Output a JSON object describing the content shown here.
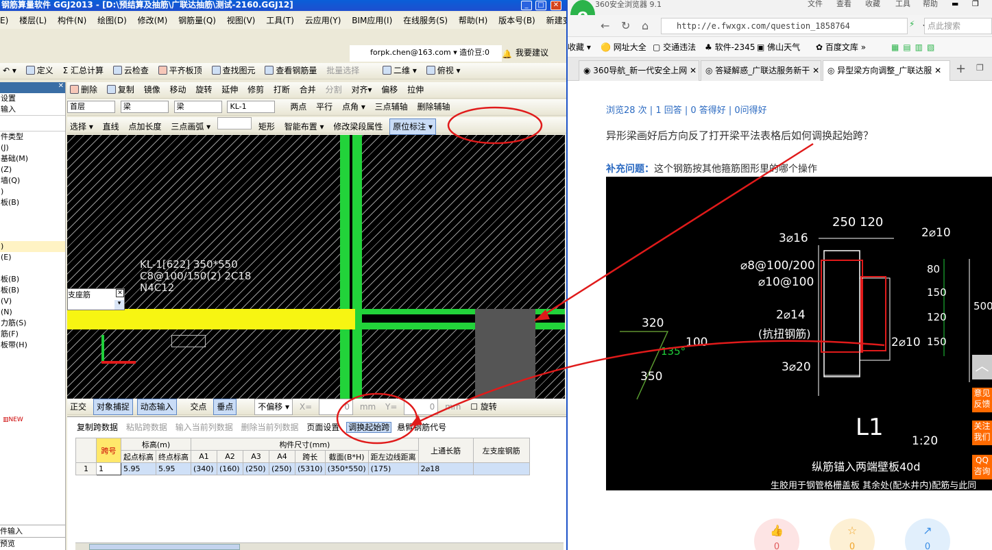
{
  "left": {
    "title": "钢筋算量软件 GGJ2013 - [D:\\预结算及抽筋\\广联达抽筋\\测试-2160.GGJ12]",
    "menu": [
      "E)",
      "楼层(L)",
      "构件(N)",
      "绘图(D)",
      "修改(M)",
      "钢筋量(Q)",
      "视图(V)",
      "工具(T)",
      "云应用(Y)",
      "BIM应用(I)",
      "在线服务(S)",
      "帮助(H)",
      "版本号(B)",
      "新建变更 ▾"
    ],
    "account": "forpk.chen@163.com ▾  造价豆:0",
    "suggest": "我要建议",
    "tb1": [
      "定义",
      "Σ 汇总计算",
      "云检查",
      "平齐板顶",
      "查找图元",
      "查看钢筋量",
      "批量选择",
      "二维 ▾",
      "俯视 ▾"
    ],
    "tb2": [
      "删除",
      "复制",
      "镜像",
      "移动",
      "旋转",
      "延伸",
      "修剪",
      "打断",
      "合并",
      "分割",
      "对齐▾",
      "偏移",
      "拉伸"
    ],
    "tb3_sel": [
      "首层",
      "梁",
      "梁",
      "KL-1"
    ],
    "tb3_btn": [
      "两点",
      "平行",
      "点角 ▾",
      "三点辅轴",
      "删除辅轴"
    ],
    "tb4": [
      "选择 ▾",
      "直线",
      "点加长度",
      "三点画弧 ▾",
      "矩形",
      "智能布置 ▾",
      "修改梁段属性",
      "原位标注 ▾"
    ],
    "panel_items": [
      "设置",
      "输入",
      "",
      "件类型",
      "(J)",
      "基础(M)",
      "(Z)",
      "墙(Q)",
      ")",
      "板(B)",
      "",
      "",
      "",
      ")",
      "(E)",
      "",
      "板(B)",
      "板(B)",
      "(V)",
      "(N)",
      "力筋(S)",
      "筋(F)",
      "板带(H)"
    ],
    "canvas_text": [
      "KL-1[622] 350*550",
      "C8@100/150(2) 2C18",
      "N4C12"
    ],
    "popup_label": "支座筋",
    "snap": [
      "正交",
      "对象捕捉",
      "动态输入",
      "交点",
      "垂点",
      "不偏移 ▾",
      "X=",
      "0",
      "mm",
      "Y=",
      "0",
      "mm",
      "旋转"
    ],
    "grid_tb": [
      "复制跨数据",
      "粘贴跨数据",
      "输入当前列数据",
      "删除当前列数据",
      "页面设置",
      "调换起始跨",
      "悬臂钢筋代号"
    ],
    "grid_head1": [
      "跨号",
      "标高(m)",
      "构件尺寸(mm)",
      "上通长筋",
      "左支座钢筋"
    ],
    "grid_head2": [
      "起点标高",
      "终点标高",
      "A1",
      "A2",
      "A3",
      "A4",
      "跨长",
      "截面(B*H)",
      "距左边线距离"
    ],
    "grid_row": [
      "1",
      "1",
      "5.95",
      "5.95",
      "(340)",
      "(160)",
      "(250)",
      "(250)",
      "(5310)",
      "(350*550)",
      "(175)",
      "2⌀18",
      ""
    ],
    "bottom_items": [
      "件输入",
      "预览"
    ]
  },
  "right": {
    "browser": "360安全浏览器 9.1",
    "topmenu": [
      "文件",
      "查看",
      "收藏",
      "工具",
      "帮助"
    ],
    "url": "http://e.fwxgx.com/question_1858764",
    "search_placeholder": "点此搜索",
    "favs": [
      "收藏 ▾",
      "网址大全",
      "交通违法",
      "软件-2345",
      "佛山天气",
      "百度文库 »"
    ],
    "tabs": [
      "360导航_新一代安全上网",
      "答疑解惑_广联达服务新干",
      "异型梁方向调整_广联达服"
    ],
    "stats": "浏览28 次 | 1 回答 | 0 答得好 | 0问得好",
    "question": "异形梁画好后方向反了打开梁平法表格后如何调换起始跨？",
    "supp_label": "补充问题：",
    "supp_text": "这个钢筋按其他箍筋图形里的哪个操作",
    "side": [
      "意见反馈",
      "关注我们",
      "QQ咨询"
    ],
    "counts": [
      "0",
      "0",
      "0"
    ],
    "cad_text": [
      "250",
      "120",
      "3⌀16",
      "2⌀10",
      "⌀8@100/200",
      "⌀10@100",
      "80",
      "150",
      "120",
      "150",
      "500",
      "2⌀14",
      "(抗扭钢筋)",
      "2⌀10",
      "320",
      "100",
      "135°",
      "350",
      "3⌀20",
      "L1",
      "1:20",
      "纵筋锚入两端壁板40d",
      "生胶用于钢管格栅盖板 其余处(配水井内)配筋与此同"
    ]
  }
}
